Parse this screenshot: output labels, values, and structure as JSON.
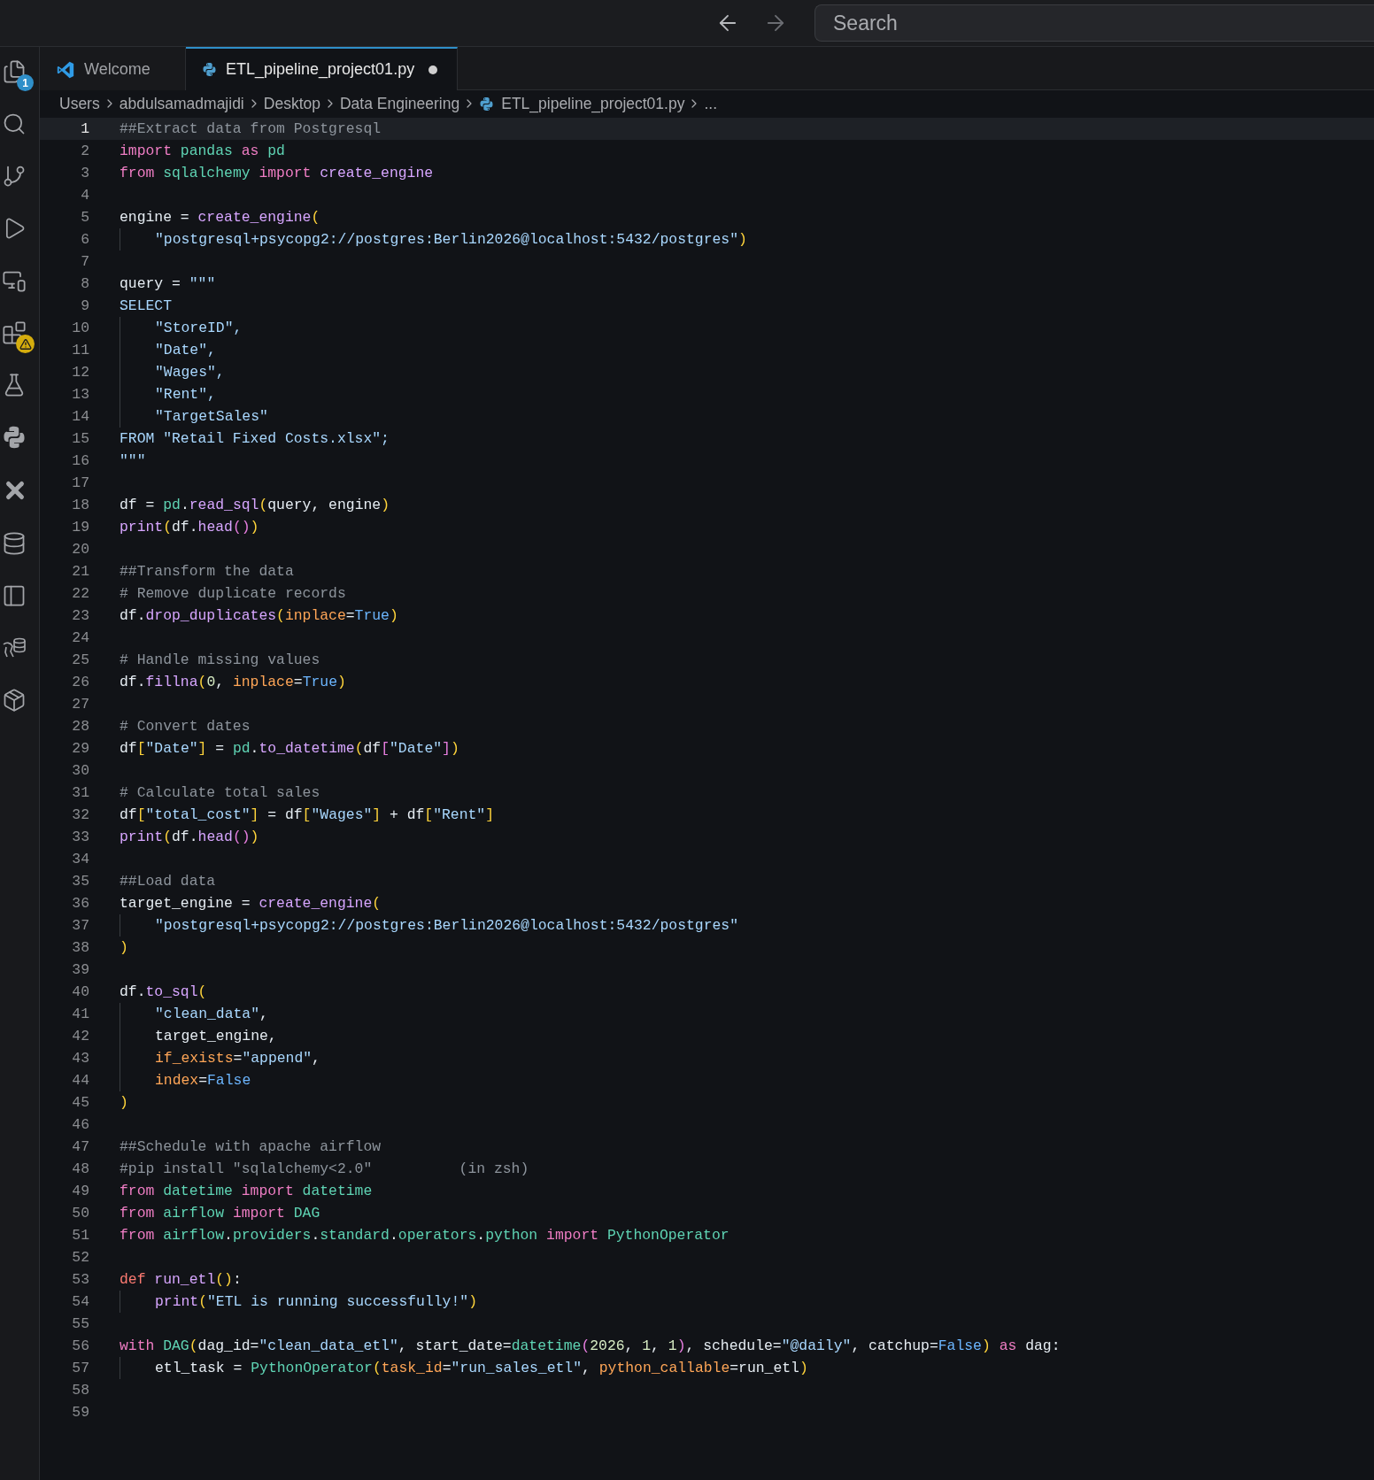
{
  "nav": [
    {
      "kind": "back",
      "disabled": false
    },
    {
      "kind": "forward",
      "disabled": true
    }
  ],
  "search": {
    "placeholder": "Search"
  },
  "activity_bar": [
    {
      "kind": "explorer",
      "badge": {
        "kind": "count",
        "text": "1"
      }
    },
    {
      "kind": "search"
    },
    {
      "kind": "source-control"
    },
    {
      "kind": "run-debug"
    },
    {
      "kind": "remote"
    },
    {
      "kind": "extensions",
      "badge": {
        "kind": "warning"
      }
    },
    {
      "kind": "testing"
    },
    {
      "kind": "python"
    },
    {
      "kind": "cross"
    },
    {
      "kind": "database"
    },
    {
      "kind": "panel"
    },
    {
      "kind": "db-elephant"
    },
    {
      "kind": "package"
    }
  ],
  "tabs": [
    {
      "label": "Welcome",
      "kind": "vscode",
      "selected": false,
      "modified": false
    },
    {
      "label": "ETL_pipeline_project01.py",
      "kind": "python",
      "selected": true,
      "modified": true
    }
  ],
  "breadcrumbs": [
    {
      "text": "Users",
      "kind": "folder"
    },
    {
      "text": "abdulsamadmajidi",
      "kind": "folder"
    },
    {
      "text": "Desktop",
      "kind": "folder"
    },
    {
      "text": "Data Engineering",
      "kind": "folder"
    },
    {
      "text": "ETL_pipeline_project01.py",
      "kind": "file"
    },
    {
      "text": "...",
      "kind": "more"
    }
  ],
  "code_lines": [
    {
      "number": "1",
      "current": true,
      "guide": false,
      "tokens": [
        {
          "text": "##Extract data from Postgresql",
          "kind": "comment"
        }
      ]
    },
    {
      "number": "2",
      "current": false,
      "guide": false,
      "tokens": [
        {
          "text": "import ",
          "kind": "keyword"
        },
        {
          "text": "pandas ",
          "kind": "module"
        },
        {
          "text": "as ",
          "kind": "keyword"
        },
        {
          "text": "pd",
          "kind": "module"
        }
      ]
    },
    {
      "number": "3",
      "current": false,
      "guide": false,
      "tokens": [
        {
          "text": "from ",
          "kind": "keyword"
        },
        {
          "text": "sqlalchemy ",
          "kind": "module"
        },
        {
          "text": "import ",
          "kind": "keyword"
        },
        {
          "text": "create_engine",
          "kind": "function"
        }
      ]
    },
    {
      "number": "4",
      "current": false,
      "guide": false
    },
    {
      "number": "5",
      "current": false,
      "guide": false,
      "tokens": [
        {
          "text": "engine = ",
          "kind": "text"
        },
        {
          "text": "create_engine",
          "kind": "function"
        },
        {
          "text": "(",
          "kind": "bracket"
        }
      ]
    },
    {
      "number": "6",
      "current": false,
      "guide": true,
      "tokens": [
        {
          "text": "\"postgresql+psycopg2://postgres:Berlin2026@localhost:5432/postgres\"",
          "kind": "string"
        },
        {
          "text": ")",
          "kind": "bracket"
        }
      ]
    },
    {
      "number": "7",
      "current": false,
      "guide": false
    },
    {
      "number": "8",
      "current": false,
      "guide": false,
      "tokens": [
        {
          "text": "query = ",
          "kind": "text"
        },
        {
          "text": "\"\"\"",
          "kind": "string"
        }
      ]
    },
    {
      "number": "9",
      "current": false,
      "guide": false,
      "tokens": [
        {
          "text": "SELECT",
          "kind": "string"
        }
      ]
    },
    {
      "number": "10",
      "current": false,
      "guide": true,
      "tokens": [
        {
          "text": "\"StoreID\",",
          "kind": "string"
        }
      ]
    },
    {
      "number": "11",
      "current": false,
      "guide": true,
      "tokens": [
        {
          "text": "\"Date\",",
          "kind": "string"
        }
      ]
    },
    {
      "number": "12",
      "current": false,
      "guide": true,
      "tokens": [
        {
          "text": "\"Wages\",",
          "kind": "string"
        }
      ]
    },
    {
      "number": "13",
      "current": false,
      "guide": true,
      "tokens": [
        {
          "text": "\"Rent\",",
          "kind": "string"
        }
      ]
    },
    {
      "number": "14",
      "current": false,
      "guide": true,
      "tokens": [
        {
          "text": "\"TargetSales\"",
          "kind": "string"
        }
      ]
    },
    {
      "number": "15",
      "current": false,
      "guide": false,
      "tokens": [
        {
          "text": "FROM \"Retail Fixed Costs.xlsx\";",
          "kind": "string"
        }
      ]
    },
    {
      "number": "16",
      "current": false,
      "guide": false,
      "tokens": [
        {
          "text": "\"\"\"",
          "kind": "string"
        }
      ]
    },
    {
      "number": "17",
      "current": false,
      "guide": false
    },
    {
      "number": "18",
      "current": false,
      "guide": false,
      "tokens": [
        {
          "text": "df = ",
          "kind": "text"
        },
        {
          "text": "pd",
          "kind": "module"
        },
        {
          "text": ".",
          "kind": "text"
        },
        {
          "text": "read_sql",
          "kind": "function"
        },
        {
          "text": "(",
          "kind": "bracket"
        },
        {
          "text": "query, engine",
          "kind": "text"
        },
        {
          "text": ")",
          "kind": "bracket"
        }
      ]
    },
    {
      "number": "19",
      "current": false,
      "guide": false,
      "tokens": [
        {
          "text": "print",
          "kind": "function"
        },
        {
          "text": "(",
          "kind": "bracket"
        },
        {
          "text": "df.",
          "kind": "text"
        },
        {
          "text": "head",
          "kind": "function"
        },
        {
          "text": "()",
          "kind": "bracket2"
        },
        {
          "text": ")",
          "kind": "bracket"
        }
      ]
    },
    {
      "number": "20",
      "current": false,
      "guide": false
    },
    {
      "number": "21",
      "current": false,
      "guide": false,
      "tokens": [
        {
          "text": "##Transform the data",
          "kind": "comment"
        }
      ]
    },
    {
      "number": "22",
      "current": false,
      "guide": false,
      "tokens": [
        {
          "text": "# Remove duplicate records",
          "kind": "comment"
        }
      ]
    },
    {
      "number": "23",
      "current": false,
      "guide": false,
      "tokens": [
        {
          "text": "df.",
          "kind": "text"
        },
        {
          "text": "drop_duplicates",
          "kind": "function"
        },
        {
          "text": "(",
          "kind": "bracket"
        },
        {
          "text": "inplace",
          "kind": "param"
        },
        {
          "text": "=",
          "kind": "text"
        },
        {
          "text": "True",
          "kind": "constant"
        },
        {
          "text": ")",
          "kind": "bracket"
        }
      ]
    },
    {
      "number": "24",
      "current": false,
      "guide": false
    },
    {
      "number": "25",
      "current": false,
      "guide": false,
      "tokens": [
        {
          "text": "# Handle missing values",
          "kind": "comment"
        }
      ]
    },
    {
      "number": "26",
      "current": false,
      "guide": false,
      "tokens": [
        {
          "text": "df.",
          "kind": "text"
        },
        {
          "text": "fillna",
          "kind": "function"
        },
        {
          "text": "(",
          "kind": "bracket"
        },
        {
          "text": "0",
          "kind": "number"
        },
        {
          "text": ", ",
          "kind": "text"
        },
        {
          "text": "inplace",
          "kind": "param"
        },
        {
          "text": "=",
          "kind": "text"
        },
        {
          "text": "True",
          "kind": "constant"
        },
        {
          "text": ")",
          "kind": "bracket"
        }
      ]
    },
    {
      "number": "27",
      "current": false,
      "guide": false
    },
    {
      "number": "28",
      "current": false,
      "guide": false,
      "tokens": [
        {
          "text": "# Convert dates",
          "kind": "comment"
        }
      ]
    },
    {
      "number": "29",
      "current": false,
      "guide": false,
      "tokens": [
        {
          "text": "df",
          "kind": "text"
        },
        {
          "text": "[",
          "kind": "bracket"
        },
        {
          "text": "\"Date\"",
          "kind": "string"
        },
        {
          "text": "]",
          "kind": "bracket"
        },
        {
          "text": " = ",
          "kind": "text"
        },
        {
          "text": "pd",
          "kind": "module"
        },
        {
          "text": ".",
          "kind": "text"
        },
        {
          "text": "to_datetime",
          "kind": "function"
        },
        {
          "text": "(",
          "kind": "bracket"
        },
        {
          "text": "df",
          "kind": "text"
        },
        {
          "text": "[",
          "kind": "bracket2"
        },
        {
          "text": "\"Date\"",
          "kind": "string"
        },
        {
          "text": "]",
          "kind": "bracket2"
        },
        {
          "text": ")",
          "kind": "bracket"
        }
      ]
    },
    {
      "number": "30",
      "current": false,
      "guide": false
    },
    {
      "number": "31",
      "current": false,
      "guide": false,
      "tokens": [
        {
          "text": "# Calculate total sales",
          "kind": "comment"
        }
      ]
    },
    {
      "number": "32",
      "current": false,
      "guide": false,
      "tokens": [
        {
          "text": "df",
          "kind": "text"
        },
        {
          "text": "[",
          "kind": "bracket"
        },
        {
          "text": "\"total_cost\"",
          "kind": "string"
        },
        {
          "text": "]",
          "kind": "bracket"
        },
        {
          "text": " = df",
          "kind": "text"
        },
        {
          "text": "[",
          "kind": "bracket"
        },
        {
          "text": "\"Wages\"",
          "kind": "string"
        },
        {
          "text": "]",
          "kind": "bracket"
        },
        {
          "text": " + df",
          "kind": "text"
        },
        {
          "text": "[",
          "kind": "bracket"
        },
        {
          "text": "\"Rent\"",
          "kind": "string"
        },
        {
          "text": "]",
          "kind": "bracket"
        }
      ]
    },
    {
      "number": "33",
      "current": false,
      "guide": false,
      "tokens": [
        {
          "text": "print",
          "kind": "function"
        },
        {
          "text": "(",
          "kind": "bracket"
        },
        {
          "text": "df.",
          "kind": "text"
        },
        {
          "text": "head",
          "kind": "function"
        },
        {
          "text": "()",
          "kind": "bracket2"
        },
        {
          "text": ")",
          "kind": "bracket"
        }
      ]
    },
    {
      "number": "34",
      "current": false,
      "guide": false
    },
    {
      "number": "35",
      "current": false,
      "guide": false,
      "tokens": [
        {
          "text": "##Load data",
          "kind": "comment"
        }
      ]
    },
    {
      "number": "36",
      "current": false,
      "guide": false,
      "tokens": [
        {
          "text": "target_engine = ",
          "kind": "text"
        },
        {
          "text": "create_engine",
          "kind": "function"
        },
        {
          "text": "(",
          "kind": "bracket"
        }
      ]
    },
    {
      "number": "37",
      "current": false,
      "guide": true,
      "tokens": [
        {
          "text": "\"postgresql+psycopg2://postgres:Berlin2026@localhost:5432/postgres\"",
          "kind": "string"
        }
      ]
    },
    {
      "number": "38",
      "current": false,
      "guide": false,
      "tokens": [
        {
          "text": ")",
          "kind": "bracket"
        }
      ]
    },
    {
      "number": "39",
      "current": false,
      "guide": false
    },
    {
      "number": "40",
      "current": false,
      "guide": false,
      "tokens": [
        {
          "text": "df.",
          "kind": "text"
        },
        {
          "text": "to_sql",
          "kind": "function"
        },
        {
          "text": "(",
          "kind": "bracket"
        }
      ]
    },
    {
      "number": "41",
      "current": false,
      "guide": true,
      "tokens": [
        {
          "text": "\"clean_data\"",
          "kind": "string"
        },
        {
          "text": ",",
          "kind": "text"
        }
      ]
    },
    {
      "number": "42",
      "current": false,
      "guide": true,
      "tokens": [
        {
          "text": "target_engine,",
          "kind": "text"
        }
      ]
    },
    {
      "number": "43",
      "current": false,
      "guide": true,
      "tokens": [
        {
          "text": "if_exists",
          "kind": "param"
        },
        {
          "text": "=",
          "kind": "text"
        },
        {
          "text": "\"append\"",
          "kind": "string"
        },
        {
          "text": ",",
          "kind": "text"
        }
      ]
    },
    {
      "number": "44",
      "current": false,
      "guide": true,
      "tokens": [
        {
          "text": "index",
          "kind": "param"
        },
        {
          "text": "=",
          "kind": "text"
        },
        {
          "text": "False",
          "kind": "constant"
        }
      ]
    },
    {
      "number": "45",
      "current": false,
      "guide": false,
      "tokens": [
        {
          "text": ")",
          "kind": "bracket"
        }
      ]
    },
    {
      "number": "46",
      "current": false,
      "guide": false
    },
    {
      "number": "47",
      "current": false,
      "guide": false,
      "tokens": [
        {
          "text": "##Schedule with apache airflow",
          "kind": "comment"
        }
      ]
    },
    {
      "number": "48",
      "current": false,
      "guide": false,
      "tokens": [
        {
          "text": "#pip install \"sqlalchemy<2.0\"          (in zsh)",
          "kind": "comment"
        }
      ]
    },
    {
      "number": "49",
      "current": false,
      "guide": false,
      "tokens": [
        {
          "text": "from ",
          "kind": "keyword"
        },
        {
          "text": "datetime ",
          "kind": "module"
        },
        {
          "text": "import ",
          "kind": "keyword"
        },
        {
          "text": "datetime",
          "kind": "module"
        }
      ]
    },
    {
      "number": "50",
      "current": false,
      "guide": false,
      "tokens": [
        {
          "text": "from ",
          "kind": "keyword"
        },
        {
          "text": "airflow ",
          "kind": "module"
        },
        {
          "text": "import ",
          "kind": "keyword"
        },
        {
          "text": "DAG",
          "kind": "module"
        }
      ]
    },
    {
      "number": "51",
      "current": false,
      "guide": false,
      "tokens": [
        {
          "text": "from ",
          "kind": "keyword"
        },
        {
          "text": "airflow",
          "kind": "module"
        },
        {
          "text": ".",
          "kind": "text"
        },
        {
          "text": "providers",
          "kind": "module"
        },
        {
          "text": ".",
          "kind": "text"
        },
        {
          "text": "standard",
          "kind": "module"
        },
        {
          "text": ".",
          "kind": "text"
        },
        {
          "text": "operators",
          "kind": "module"
        },
        {
          "text": ".",
          "kind": "text"
        },
        {
          "text": "python ",
          "kind": "module"
        },
        {
          "text": "import ",
          "kind": "keyword"
        },
        {
          "text": "PythonOperator",
          "kind": "module"
        }
      ]
    },
    {
      "number": "52",
      "current": false,
      "guide": false
    },
    {
      "number": "53",
      "current": false,
      "guide": false,
      "tokens": [
        {
          "text": "def ",
          "kind": "def"
        },
        {
          "text": "run_etl",
          "kind": "function"
        },
        {
          "text": "()",
          "kind": "bracket"
        },
        {
          "text": ":",
          "kind": "text"
        }
      ]
    },
    {
      "number": "54",
      "current": false,
      "guide": true,
      "tokens": [
        {
          "text": "print",
          "kind": "function"
        },
        {
          "text": "(",
          "kind": "bracket"
        },
        {
          "text": "\"ETL is running successfully!\"",
          "kind": "string"
        },
        {
          "text": ")",
          "kind": "bracket"
        }
      ]
    },
    {
      "number": "55",
      "current": false,
      "guide": false
    },
    {
      "number": "56",
      "current": false,
      "guide": false,
      "tokens": [
        {
          "text": "with ",
          "kind": "keyword"
        },
        {
          "text": "DAG",
          "kind": "module"
        },
        {
          "text": "(",
          "kind": "bracket"
        },
        {
          "text": "dag_id=",
          "kind": "text"
        },
        {
          "text": "\"clean_data_etl\"",
          "kind": "string"
        },
        {
          "text": ", start_date=",
          "kind": "text"
        },
        {
          "text": "datetime",
          "kind": "module"
        },
        {
          "text": "(",
          "kind": "bracket2"
        },
        {
          "text": "2026",
          "kind": "number"
        },
        {
          "text": ", ",
          "kind": "text"
        },
        {
          "text": "1",
          "kind": "number"
        },
        {
          "text": ", ",
          "kind": "text"
        },
        {
          "text": "1",
          "kind": "number"
        },
        {
          "text": ")",
          "kind": "bracket2"
        },
        {
          "text": ", schedule=",
          "kind": "text"
        },
        {
          "text": "\"@daily\"",
          "kind": "string"
        },
        {
          "text": ", catchup=",
          "kind": "text"
        },
        {
          "text": "False",
          "kind": "constant"
        },
        {
          "text": ")",
          "kind": "bracket"
        },
        {
          "text": " as ",
          "kind": "keyword"
        },
        {
          "text": "dag:",
          "kind": "text"
        }
      ]
    },
    {
      "number": "57",
      "current": false,
      "guide": true,
      "tokens": [
        {
          "text": "etl_task = ",
          "kind": "text"
        },
        {
          "text": "PythonOperator",
          "kind": "module"
        },
        {
          "text": "(",
          "kind": "bracket"
        },
        {
          "text": "task_id",
          "kind": "param"
        },
        {
          "text": "=",
          "kind": "text"
        },
        {
          "text": "\"run_sales_etl\"",
          "kind": "string"
        },
        {
          "text": ", ",
          "kind": "text"
        },
        {
          "text": "python_callable",
          "kind": "param"
        },
        {
          "text": "=",
          "kind": "text"
        },
        {
          "text": "run_etl",
          "kind": "text"
        },
        {
          "text": ")",
          "kind": "bracket"
        }
      ]
    },
    {
      "number": "58",
      "current": false,
      "guide": false
    },
    {
      "number": "59",
      "current": false,
      "guide": false
    }
  ]
}
